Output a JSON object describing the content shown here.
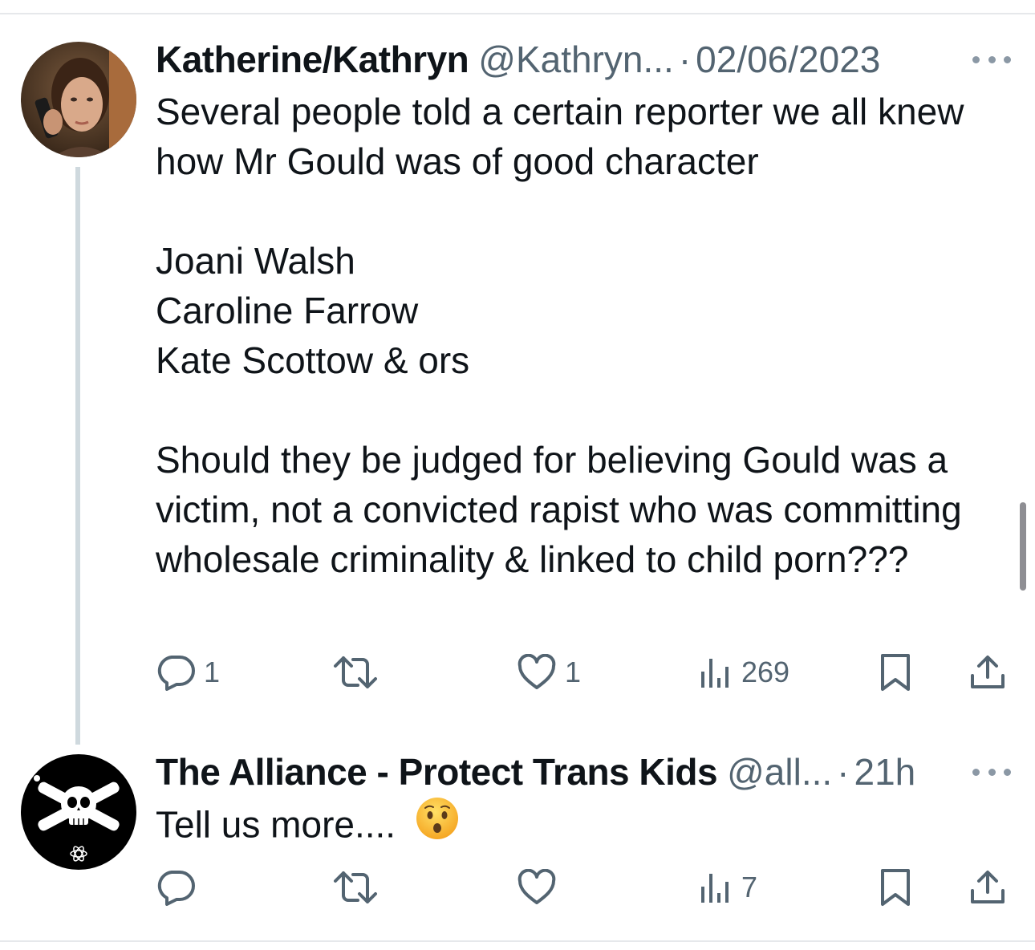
{
  "tweets": [
    {
      "name": "Katherine/Kathryn",
      "handle": "@Kathryn...",
      "separator": "·",
      "time": "02/06/2023",
      "body": [
        "Several people told a certain reporter we all knew how Mr Gould was of good character",
        "",
        "Joani Walsh",
        "Caroline Farrow",
        "Kate Scottow & ors",
        "",
        "Should they be judged for believing Gould was a victim, not a convicted rapist who was committing wholesale criminality & linked to child porn???"
      ],
      "replies": "1",
      "retweets": "",
      "likes": "1",
      "views": "269"
    },
    {
      "name": "The Alliance - Protect Trans Kids",
      "handle": "@all...",
      "separator": "·",
      "time": "21h",
      "body_text": "Tell us more....",
      "emoji": "hushed-face-emoji",
      "replies": "",
      "retweets": "",
      "likes": "",
      "views": "7"
    }
  ],
  "icons": {
    "reply": "reply-icon",
    "retweet": "retweet-icon",
    "like": "heart-icon",
    "views": "views-icon",
    "bookmark": "bookmark-icon",
    "share": "share-icon",
    "more": "more-icon"
  },
  "colors": {
    "text": "#0f1419",
    "secondary": "#536471",
    "thread_line": "#cfd9de",
    "divider": "#e6e8eb"
  }
}
